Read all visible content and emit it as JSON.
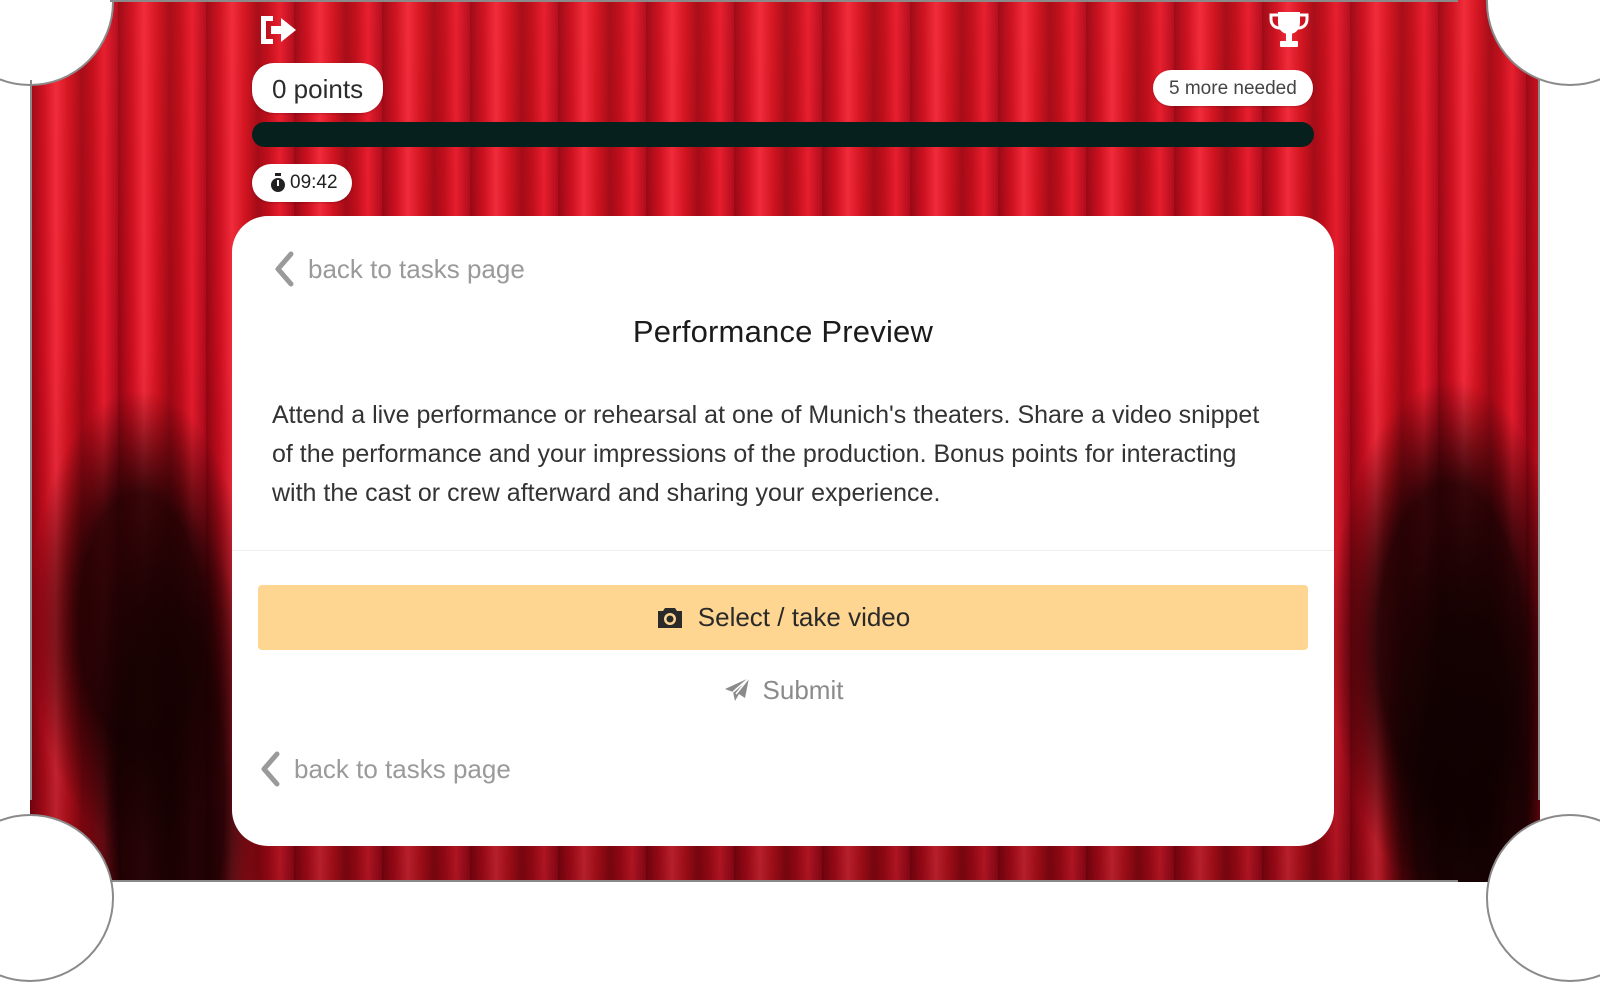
{
  "header": {
    "exit_icon": "sign-out-icon",
    "trophy_icon": "trophy-icon",
    "points_label": "0 points",
    "needed_label": "5 more needed",
    "progress_fraction": 0,
    "timer_icon": "stopwatch-icon",
    "timer_value": "09:42"
  },
  "task": {
    "back_label_top": "back to tasks page",
    "title": "Performance Preview",
    "description": "Attend a live performance or rehearsal at one of Munich's theaters. Share a video snippet of the performance and your impressions of the production. Bonus points for interacting with the cast or crew afterward and sharing your experience.",
    "select_icon": "camera-icon",
    "select_label": "Select / take video",
    "submit_icon": "paper-plane-icon",
    "submit_label": "Submit",
    "back_label_bottom": "back to tasks page"
  },
  "colors": {
    "curtain": "#c20b1c",
    "progress_track": "#06201d",
    "select_button": "#fed591",
    "muted_text": "#9a9a9a"
  }
}
